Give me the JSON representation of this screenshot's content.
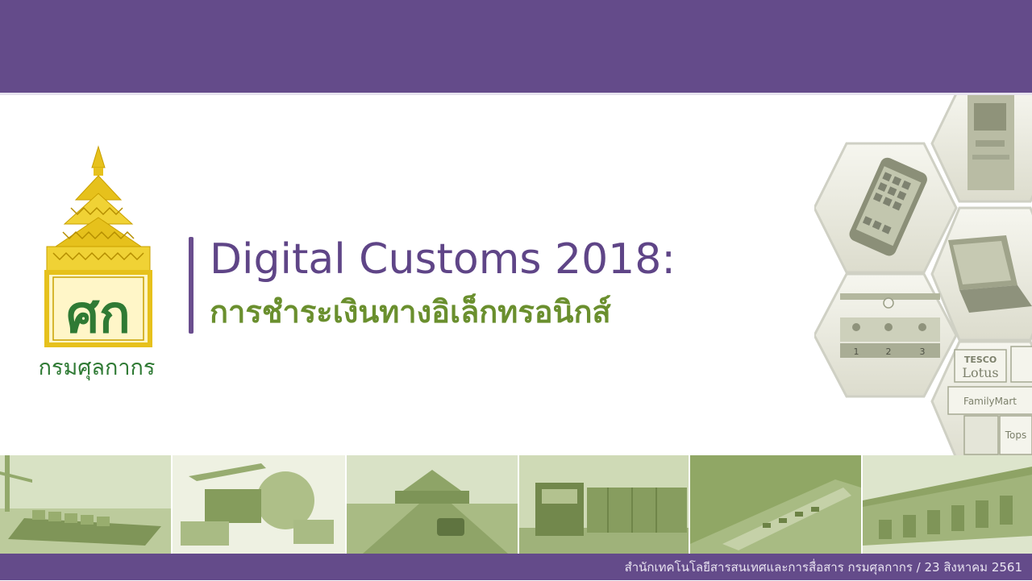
{
  "slide": {
    "title": "Digital Customs 2018:",
    "subtitle": "การชำระเงินทางอิเล็กทรอนิกส์",
    "footer": "สำนักเทคโนโลยีสารสนเทศและการสื่อสาร กรมศุลกากร / 23 สิงหาคม 2561"
  },
  "logo": {
    "text": "กรมศุลกากร",
    "emblem_letters": "ศก"
  },
  "hex_images": {
    "store_logos": [
      "TESCO",
      "Lotus",
      "FamilyMart",
      "Tops"
    ],
    "queue_numbers": [
      "1",
      "2",
      "3"
    ]
  },
  "colors": {
    "header_purple": "#644b8a",
    "title_purple": "#5f4587",
    "subtitle_green": "#6a8f2e",
    "logo_gold": "#e6c11c",
    "logo_green": "#2f7a34",
    "photo_green": "#a8bd7c"
  }
}
